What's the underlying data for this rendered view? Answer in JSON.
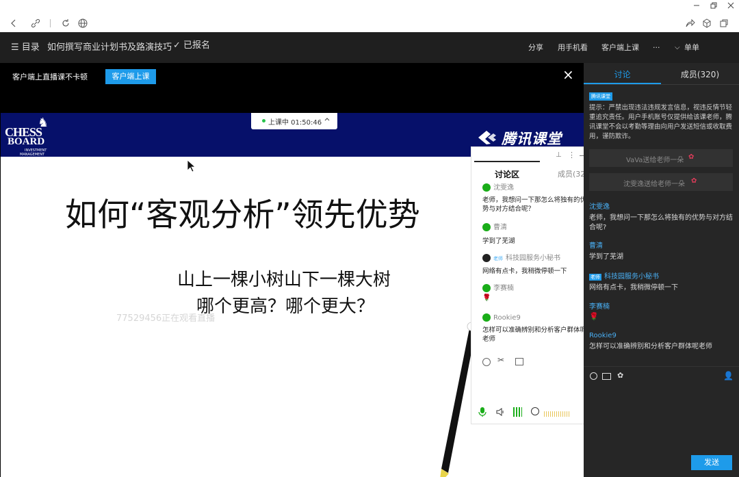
{
  "window": {
    "minimize_icon": "minimize-icon",
    "restore_icon": "restore-icon",
    "close_icon": "close-icon"
  },
  "toolbar": {
    "icons": [
      "back-icon",
      "link-icon",
      "refresh-icon",
      "globe-icon",
      "share-icon",
      "cube-icon",
      "window-icon"
    ]
  },
  "topbar": {
    "menu_label": "☰ 目录",
    "course_title": "如何撰写商业计划书及路演技巧",
    "enrolled": "✓ 已报名",
    "share": "分享",
    "phone": "用手机看",
    "client": "客户端上课",
    "more": "···",
    "single": "单单"
  },
  "notice": {
    "text": "客户端上直播课不卡顿",
    "button": "客户端上课",
    "close": "×"
  },
  "live": {
    "status": "上课中 01:50:46",
    "chevron": "^"
  },
  "slide": {
    "logo_line1": "CHESS",
    "logo_line2": "BOARD",
    "logo_sub1": "INVESTMENT",
    "logo_sub2": "MANAGEMENT",
    "brand": "腾讯课堂",
    "title": "如何“客观分析”领先优势",
    "line1": "山上一棵小树山下一棵大树",
    "line2": "哪个更高？哪个更大？",
    "watermark": "77529456正在观看直播"
  },
  "float_chat": {
    "tab_discuss": "讨论区",
    "tab_members": "成员(32",
    "pin": "⊥",
    "dots": "⋮",
    "messages": [
      {
        "name": "沈雯逸",
        "text": "老师，我想问一下那怎么将独有的优势与对方结合呢？",
        "kind": "user"
      },
      {
        "name": "曹清",
        "text": "学到了芜湖",
        "kind": "user"
      },
      {
        "name": "科技园服务小秘书",
        "badge": "老师",
        "text": "网络有点卡，我稍微停顿一下",
        "kind": "teacher"
      },
      {
        "name": "李赛楠",
        "text": "🌹",
        "kind": "user"
      },
      {
        "name": "Rookie9",
        "text": "怎样可以准确辨别和分析客户群体呢老师",
        "kind": "user"
      }
    ]
  },
  "side": {
    "tab_discuss": "讨论",
    "tab_members": "成员(320)",
    "tag": "腾讯课堂",
    "tip": "提示：严禁出现违法违规发言信息，视违反情节轻重追究责任。用户手机账号仅提供给该课老师，腾讯课堂不会以考勤等理由向用户发送短信或收取费用，谨防欺诈。",
    "gift1": "VaVa送给老师一朵",
    "gift2": "沈雯逸送给老师一朵",
    "messages": [
      {
        "name": "沈雯逸",
        "text": "老师，我想问一下那怎么将独有的优势与对方结合呢?"
      },
      {
        "name": "曹清",
        "text": "学到了芜湖"
      },
      {
        "badge": "老师",
        "name": "科技园服务小秘书",
        "text": "网络有点卡，我稍微停顿一下"
      },
      {
        "name": "李赛楠",
        "text": "🌹"
      },
      {
        "name": "Rookie9",
        "text": "怎样可以准确辨别和分析客户群体呢老师"
      }
    ],
    "send": "发送"
  },
  "colors": {
    "accent": "#1e9bea",
    "topbar": "#1f1f1f",
    "side": "#262626",
    "slide_banner": "#06106a"
  }
}
